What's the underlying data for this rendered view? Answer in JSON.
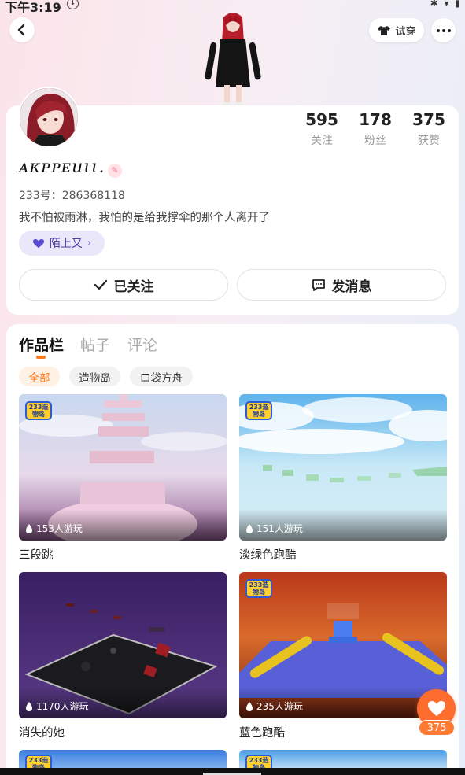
{
  "status_bar": {
    "time": "下午3:19"
  },
  "header": {
    "try_on_label": "试穿"
  },
  "profile": {
    "stats": [
      {
        "value": "595",
        "label": "关注"
      },
      {
        "value": "178",
        "label": "粉丝"
      },
      {
        "value": "375",
        "label": "获赞"
      }
    ],
    "username": "ᴀᴋᴘᴘᴇuɩɩ.",
    "uid": "233号：286368118",
    "bio": "我不怕被雨淋，我怕的是给我撑伞的那个人离开了",
    "tag_label": "陌上又",
    "follow_label": "已关注",
    "message_label": "发消息"
  },
  "tabs": [
    {
      "label": "作品栏",
      "active": true
    },
    {
      "label": "帖子",
      "active": false
    },
    {
      "label": "评论",
      "active": false
    }
  ],
  "filters": [
    {
      "label": "全部",
      "active": true
    },
    {
      "label": "造物岛",
      "active": false
    },
    {
      "label": "口袋方舟",
      "active": false
    }
  ],
  "logo_text": "233造物岛",
  "games": [
    {
      "title": "三段跳",
      "plays": "153人游玩"
    },
    {
      "title": "淡绿色跑酷",
      "plays": "151人游玩"
    },
    {
      "title": "消失的她",
      "plays": "1170人游玩"
    },
    {
      "title": "蓝色跑酷",
      "plays": "235人游玩"
    }
  ],
  "like_count": "375",
  "colors": {
    "accent": "#ff7b1c",
    "tag_bg": "#ebe7fb",
    "like": "#ff6d2e"
  }
}
